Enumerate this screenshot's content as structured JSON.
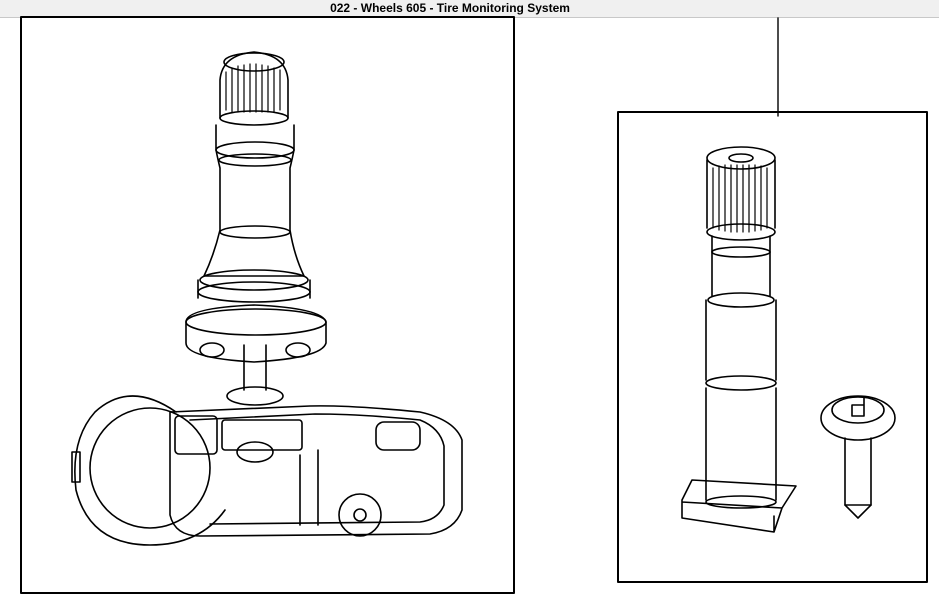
{
  "window": {
    "title": "022 - Wheels 605 - Tire Monitoring System"
  },
  "diagram": {
    "line_color": "#000000",
    "background": "#ffffff",
    "parts": [
      "tire-pressure-sensor-assembly",
      "valve-stem",
      "mounting-screw"
    ]
  }
}
